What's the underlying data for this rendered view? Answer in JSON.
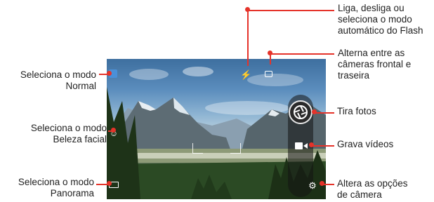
{
  "callouts": {
    "flash": "Liga, desliga ou seleciona o modo automático do Flash",
    "flash_lines": [
      "Liga, desliga ou",
      "seleciona o modo",
      "automático do Flash"
    ],
    "switch_camera_lines": [
      "Alterna entre as",
      "câmeras frontal e",
      "traseira"
    ],
    "normal_mode_lines": [
      "Seleciona o modo",
      "Normal"
    ],
    "beauty_mode_lines": [
      "Seleciona o modo",
      "Beleza facial"
    ],
    "panorama_mode_lines": [
      "Seleciona o modo",
      "Panorama"
    ],
    "take_photo": "Tira fotos",
    "record_video": "Grava vídeos",
    "settings_lines": [
      "Altera as opções",
      "de câmera"
    ]
  },
  "icons": {
    "normal_mode": "normal-mode-icon",
    "beauty_mode": "beauty-face-icon",
    "panorama_mode": "panorama-icon",
    "flash": "flash-icon",
    "switch_camera": "switch-camera-icon",
    "shutter": "shutter-icon",
    "record": "video-record-icon",
    "settings": "gear-icon"
  },
  "colors": {
    "leader": "#e5332a",
    "accent_mode": "#4a90d9"
  }
}
